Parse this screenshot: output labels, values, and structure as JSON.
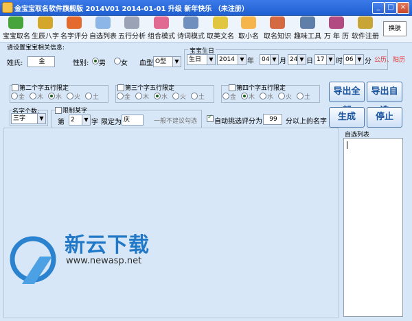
{
  "window": {
    "title": "金宝宝取名软件旗舰版 2014V01  2014-01-01 升级 新年快乐 （未注册）",
    "minimize": "_",
    "maximize": "□",
    "close": "×"
  },
  "toolbar": {
    "items": [
      {
        "label": "宝宝取名",
        "icon": "people-icon",
        "color": "#47a33b"
      },
      {
        "label": "生辰八字",
        "icon": "search-icon",
        "color": "#d4a62a"
      },
      {
        "label": "名字评分",
        "icon": "balls-icon",
        "color": "#e46b2d"
      },
      {
        "label": "自选列表",
        "icon": "list-icon",
        "color": "#8cb6e8"
      },
      {
        "label": "五行分析",
        "icon": "gears-icon",
        "color": "#9aa3b5"
      },
      {
        "label": "组合模式",
        "icon": "puzzle-icon",
        "color": "#e06a91"
      },
      {
        "label": "诗词模式",
        "icon": "book-icon",
        "color": "#6f8fbe"
      },
      {
        "label": "取英文名",
        "icon": "star-icon",
        "color": "#e1c640"
      },
      {
        "label": "取小名",
        "icon": "bubble-icon",
        "color": "#f5b54b"
      },
      {
        "label": "取名知识",
        "icon": "cube-icon",
        "color": "#d46942"
      },
      {
        "label": "趣味工具",
        "icon": "tools-icon",
        "color": "#5f7fa8"
      },
      {
        "label": "万 年 历",
        "icon": "calendar-icon",
        "color": "#b14b82"
      },
      {
        "label": "软件注册",
        "icon": "key-icon",
        "color": "#c9a437"
      }
    ],
    "switch_skin": "换肤"
  },
  "form": {
    "section_title": "请设置宝宝相关信息:",
    "surname_label": "姓氏:",
    "surname_value": "金",
    "gender_label": "性别:",
    "male": "男",
    "female": "女",
    "blood_label": "血型:",
    "blood_value": "O型",
    "birth_group_title": "宝宝生日",
    "birth_type": "生日",
    "year_value": "2014",
    "year_label": "年",
    "month_value": "04",
    "month_label": "月",
    "day_value": "24",
    "day_label": "日",
    "hour_value": "17",
    "hour_label": "时",
    "minute_value": "06",
    "minute_label": "分",
    "calendar_note": "公历、阳历"
  },
  "wuxing_groups": [
    {
      "title": "第二个字五行限定",
      "options": [
        "金",
        "木",
        "水",
        "火",
        "土"
      ],
      "selected": 2
    },
    {
      "title": "第三个字五行限定",
      "options": [
        "金",
        "木",
        "水",
        "火",
        "土"
      ],
      "selected": 2
    },
    {
      "title": "第四个字五行限定",
      "options": [
        "金",
        "木",
        "水",
        "火",
        "土"
      ],
      "selected": 1
    }
  ],
  "name_options": {
    "count_title": "名字个数:",
    "count_value": "三字",
    "restrict_title": "限制某字",
    "position_prefix": "第",
    "position_value": "2",
    "position_suffix": "字",
    "limit_label": "限定为",
    "limit_value": "庆",
    "hint": "一般不建议勾选"
  },
  "score_filter": {
    "label": "自动挑选评分为:",
    "value": "99",
    "suffix": "分以上的名字"
  },
  "buttons": {
    "export_all": "导出全部",
    "export_selected": "导出自选",
    "generate": "生成",
    "stop": "停止"
  },
  "self_list": {
    "title": "自选列表"
  },
  "watermark": {
    "text": "新云下载",
    "url": "www.newasp.net"
  }
}
